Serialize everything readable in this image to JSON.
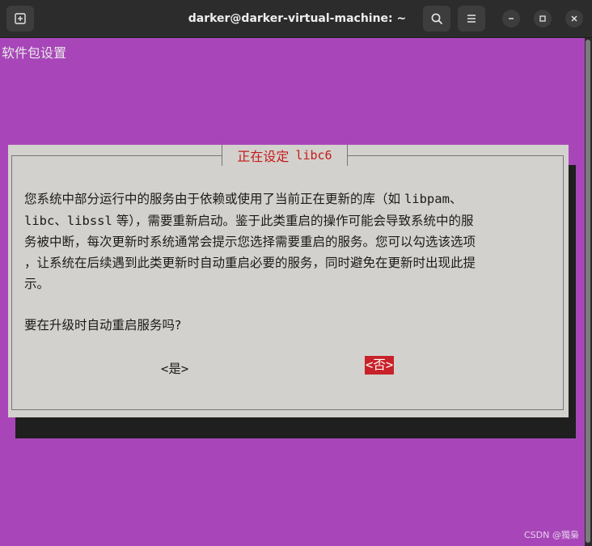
{
  "window": {
    "title": "darker@darker-virtual-machine: ~",
    "icons": {
      "new_tab": "new-tab-icon",
      "search": "search-icon",
      "menu": "hamburger-menu-icon",
      "minimize": "minimize-icon",
      "maximize": "maximize-icon",
      "close": "close-icon"
    }
  },
  "terminal": {
    "backtitle": "软件包设置",
    "background_color": "#a846b9"
  },
  "dialog": {
    "title_cn": "正在设定",
    "title_pkg": "libc6",
    "body_lines": [
      [
        "您系统中部分运行中的服务由于依赖或使用了当前正在更新的库（如 ",
        "libpam",
        "、"
      ],
      [
        "libc",
        "、",
        "libssl",
        " 等），需要重新启动。鉴于此类重启的操作可能会导致系统中的服"
      ],
      [
        "务被中断，每次更新时系统通常会提示您选择需要重启的服务。您可以勾选该选项"
      ],
      [
        "，让系统在后续遇到此类更新时自动重启必要的服务，同时避免在更新时出现此提"
      ],
      [
        "示。"
      ]
    ],
    "question": "要在升级时自动重启服务吗?",
    "yes_button": "<是>",
    "no_button": "<否>",
    "selected_button_color": "#c8212a"
  },
  "watermark": "CSDN @獨梟"
}
